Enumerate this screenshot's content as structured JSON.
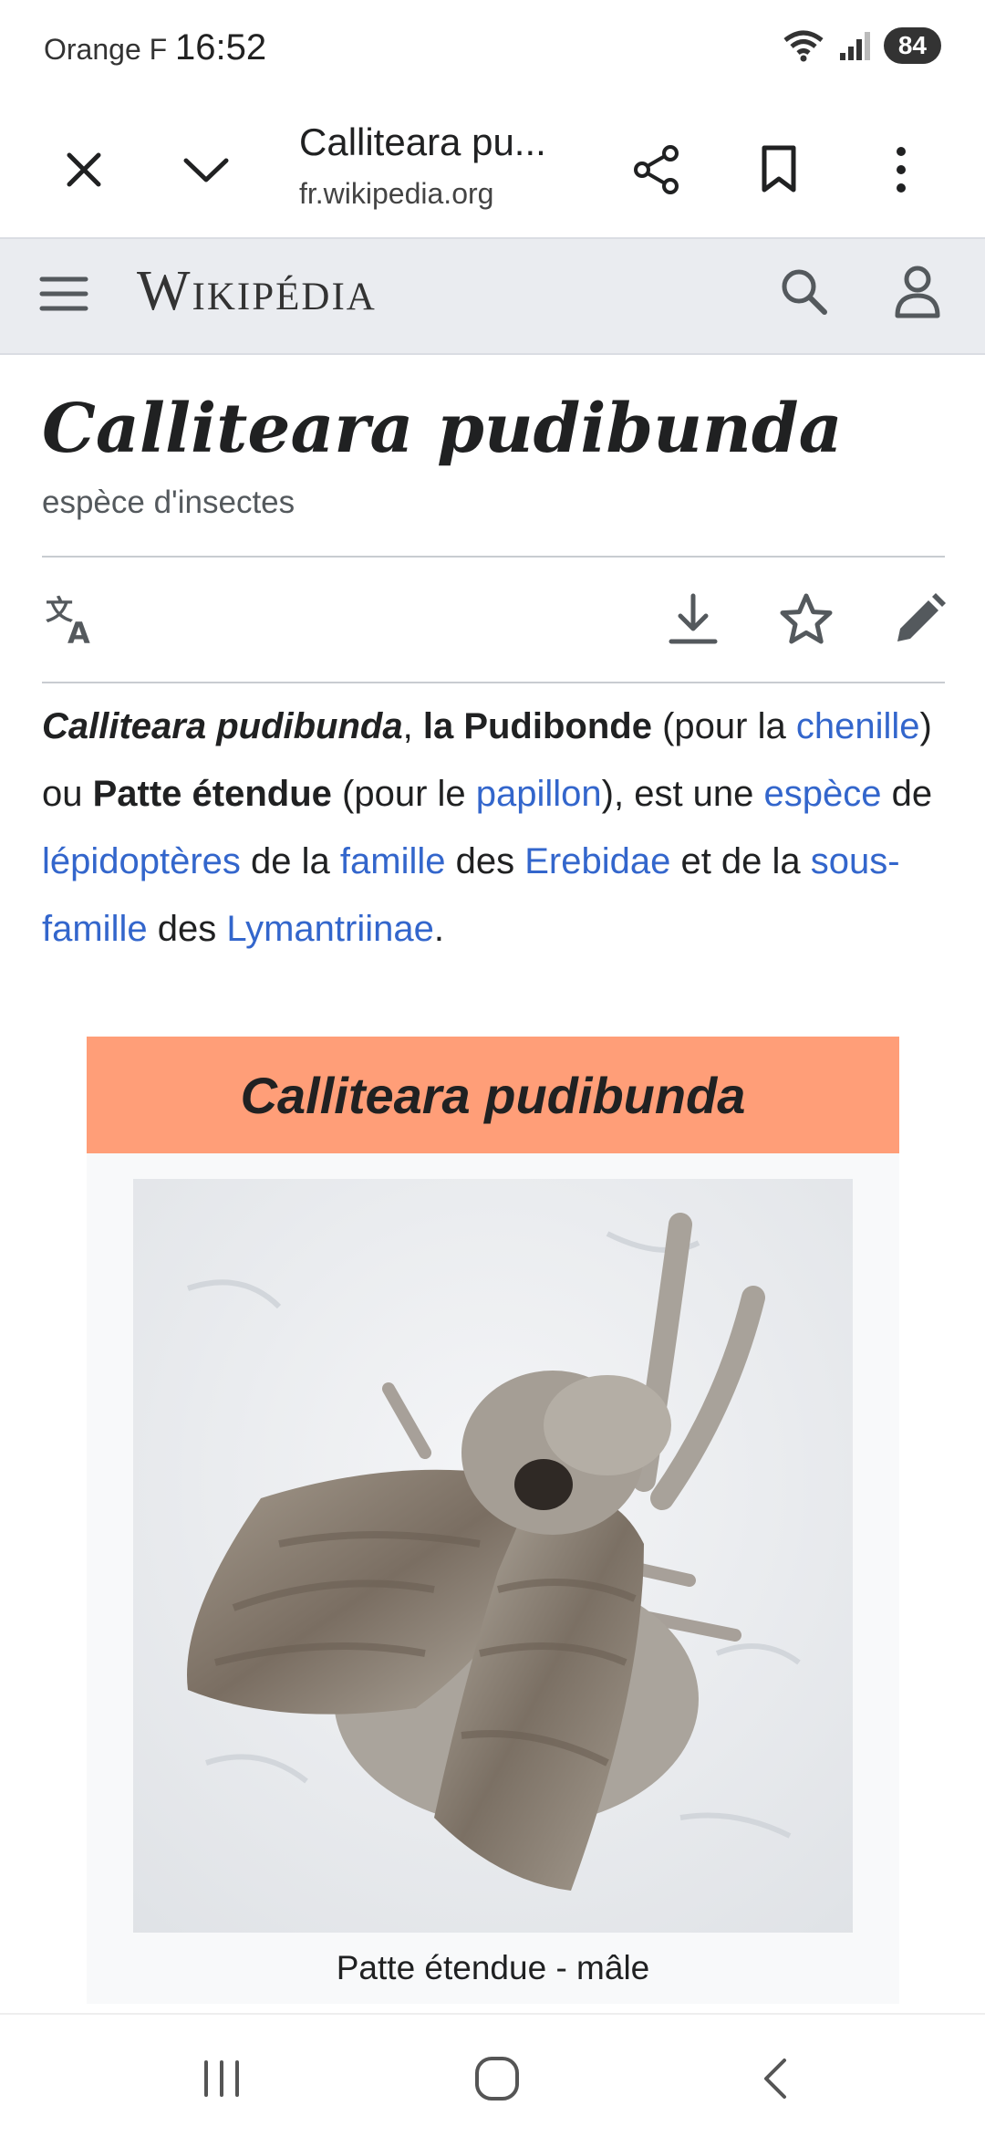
{
  "status_bar": {
    "carrier": "Orange F",
    "time": "16:52",
    "battery": "84"
  },
  "custom_tab": {
    "title": "Calliteara pu...",
    "url": "fr.wikipedia.org"
  },
  "wiki_header": {
    "wordmark": "Wikipédia"
  },
  "article": {
    "title": "Calliteara pudibunda",
    "description": "espèce d'insectes",
    "lead": [
      {
        "t": "Calliteara pudibunda",
        "s": "bi"
      },
      {
        "t": ", ",
        "s": "n"
      },
      {
        "t": "la Pudibonde",
        "s": "b"
      },
      {
        "t": " (pour la ",
        "s": "n"
      },
      {
        "t": "chenille",
        "s": "l"
      },
      {
        "t": ") ou ",
        "s": "n"
      },
      {
        "t": "Patte étendue",
        "s": "b"
      },
      {
        "t": " (pour le ",
        "s": "n"
      },
      {
        "t": "papillon",
        "s": "l"
      },
      {
        "t": "), est une ",
        "s": "n"
      },
      {
        "t": "espèce",
        "s": "l"
      },
      {
        "t": " de ",
        "s": "n"
      },
      {
        "t": "lépidoptères",
        "s": "l"
      },
      {
        "t": " de la ",
        "s": "n"
      },
      {
        "t": "famille",
        "s": "l"
      },
      {
        "t": " des ",
        "s": "n"
      },
      {
        "t": "Erebidae",
        "s": "l"
      },
      {
        "t": " et de la ",
        "s": "n"
      },
      {
        "t": "sous-famille",
        "s": "l"
      },
      {
        "t": " des ",
        "s": "n"
      },
      {
        "t": "Lymantriinae",
        "s": "l"
      },
      {
        "t": ".",
        "s": "n"
      }
    ]
  },
  "infobox": {
    "title": "Calliteara pudibunda",
    "caption": "Patte étendue - mâle",
    "header_color": "#ff9e78"
  },
  "colors": {
    "link": "#3366cc",
    "header_bg": "#eaecf0"
  }
}
